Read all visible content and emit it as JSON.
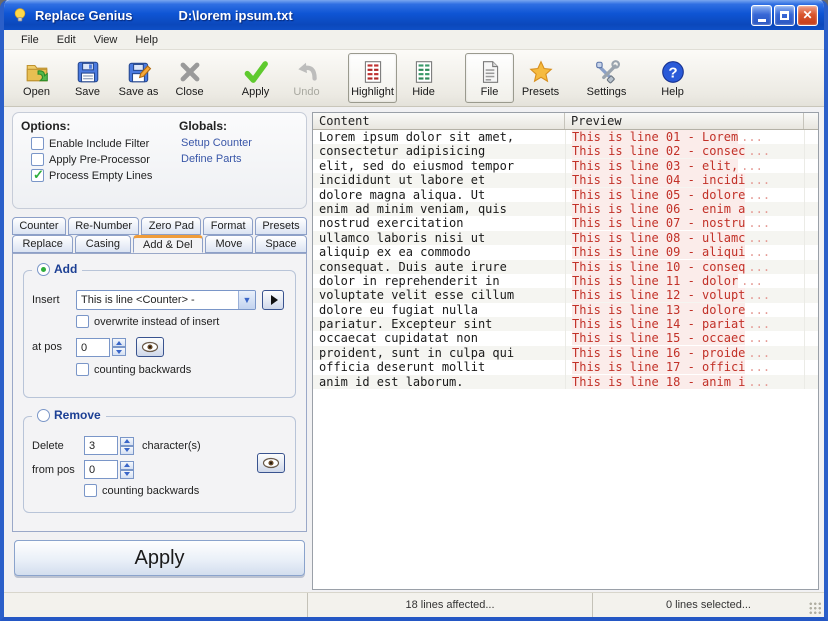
{
  "window": {
    "app_title": "Replace Genius",
    "file_path": "D:\\lorem ipsum.txt"
  },
  "menu": {
    "items": [
      "File",
      "Edit",
      "View",
      "Help"
    ]
  },
  "toolbar": {
    "buttons": [
      {
        "id": "open",
        "label": "Open",
        "icon": "open-folder-icon",
        "state": "normal",
        "group_gap": false
      },
      {
        "id": "save",
        "label": "Save",
        "icon": "save-floppy-icon",
        "state": "normal",
        "group_gap": false
      },
      {
        "id": "saveas",
        "label": "Save as",
        "icon": "save-as-floppy-pencil-icon",
        "state": "normal",
        "group_gap": false
      },
      {
        "id": "close",
        "label": "Close",
        "icon": "close-x-icon",
        "state": "normal",
        "group_gap": false
      },
      {
        "id": "apply",
        "label": "Apply",
        "icon": "apply-check-icon",
        "state": "normal",
        "group_gap": true
      },
      {
        "id": "undo",
        "label": "Undo",
        "icon": "undo-arrow-icon",
        "state": "disabled",
        "group_gap": false
      },
      {
        "id": "highlight",
        "label": "Highlight",
        "icon": "highlight-document-icon",
        "state": "toggled",
        "group_gap": true
      },
      {
        "id": "hide",
        "label": "Hide",
        "icon": "hide-document-icon",
        "state": "normal",
        "group_gap": false
      },
      {
        "id": "file",
        "label": "File",
        "icon": "file-document-icon",
        "state": "toggled",
        "group_gap": true
      },
      {
        "id": "presets",
        "label": "Presets",
        "icon": "presets-star-icon",
        "state": "normal",
        "group_gap": false
      },
      {
        "id": "settings",
        "label": "Settings",
        "icon": "settings-tools-icon",
        "state": "normal",
        "group_gap": true
      },
      {
        "id": "help",
        "label": "Help",
        "icon": "help-question-icon",
        "state": "normal",
        "group_gap": true
      }
    ]
  },
  "options": {
    "title": "Options:",
    "checkboxes": [
      {
        "label": "Enable Include Filter",
        "checked": false
      },
      {
        "label": "Apply Pre-Processor",
        "checked": false
      },
      {
        "label": "Process Empty Lines",
        "checked": true
      }
    ]
  },
  "globals": {
    "title": "Globals:",
    "links": [
      "Setup Counter",
      "Define Parts"
    ]
  },
  "tabs": {
    "row1": [
      "Counter",
      "Re-Number",
      "Zero Pad",
      "Format",
      "Presets"
    ],
    "row2": [
      "Replace",
      "Casing",
      "Add & Del",
      "Move",
      "Space"
    ],
    "active": "Add & Del"
  },
  "add_section": {
    "legend": "Add",
    "selected": true,
    "insert_label": "Insert",
    "insert_value": "This is line <Counter> - ",
    "overwrite_label": "overwrite instead of insert",
    "overwrite_checked": false,
    "at_pos_label": "at pos",
    "at_pos_value": "0",
    "counting_label": "counting backwards",
    "counting_checked": false
  },
  "remove_section": {
    "legend": "Remove",
    "selected": false,
    "delete_label": "Delete",
    "delete_value": "3",
    "delete_suffix": "character(s)",
    "from_pos_label": "from pos",
    "from_pos_value": "0",
    "counting_label": "counting backwards",
    "counting_checked": false
  },
  "apply_button_label": "Apply",
  "list": {
    "columns": [
      "Content",
      "Preview"
    ],
    "rows": [
      {
        "content": "Lorem ipsum dolor sit amet,",
        "preview": "This is line 01 - Lorem",
        "ellipsis": "..."
      },
      {
        "content": "consectetur adipisicing",
        "preview": "This is line 02 - consec",
        "ellipsis": "..."
      },
      {
        "content": "elit, sed do eiusmod tempor",
        "preview": "This is line 03 - elit,",
        "ellipsis": "..."
      },
      {
        "content": "incididunt ut labore et",
        "preview": "This is line 04 - incidi",
        "ellipsis": "..."
      },
      {
        "content": "dolore magna aliqua. Ut",
        "preview": "This is line 05 - dolore",
        "ellipsis": "..."
      },
      {
        "content": "enim ad minim veniam, quis",
        "preview": "This is line 06 - enim a",
        "ellipsis": "..."
      },
      {
        "content": "nostrud exercitation",
        "preview": "This is line 07 - nostru",
        "ellipsis": "..."
      },
      {
        "content": "ullamco laboris nisi ut",
        "preview": "This is line 08 - ullamc",
        "ellipsis": "..."
      },
      {
        "content": "aliquip ex ea commodo",
        "preview": "This is line 09 - aliqui",
        "ellipsis": "..."
      },
      {
        "content": "consequat. Duis aute irure",
        "preview": "This is line 10 - conseq",
        "ellipsis": "..."
      },
      {
        "content": "dolor in reprehenderit in",
        "preview": "This is line 11 - dolor",
        "ellipsis": "..."
      },
      {
        "content": "voluptate velit esse cillum",
        "preview": "This is line 12 - volupt",
        "ellipsis": "..."
      },
      {
        "content": "dolore eu fugiat nulla",
        "preview": "This is line 13 - dolore",
        "ellipsis": "..."
      },
      {
        "content": "pariatur. Excepteur sint",
        "preview": "This is line 14 - pariat",
        "ellipsis": "..."
      },
      {
        "content": "occaecat cupidatat non",
        "preview": "This is line 15 - occaec",
        "ellipsis": "..."
      },
      {
        "content": "proident, sunt in culpa qui",
        "preview": "This is line 16 - proide",
        "ellipsis": "..."
      },
      {
        "content": "officia deserunt mollit",
        "preview": "This is line 17 - offici",
        "ellipsis": "..."
      },
      {
        "content": "anim id est laborum.",
        "preview": "This is line 18 - anim i",
        "ellipsis": "..."
      }
    ]
  },
  "status": {
    "affected": "18 lines affected...",
    "selected": "0 lines selected..."
  },
  "colors": {
    "titlebar_blue": "#0f55d4",
    "preview_red": "#c23128",
    "tab_active_orange": "#ef9c3a",
    "check_green": "#2fae3c",
    "link_blue": "#3a57a8"
  }
}
